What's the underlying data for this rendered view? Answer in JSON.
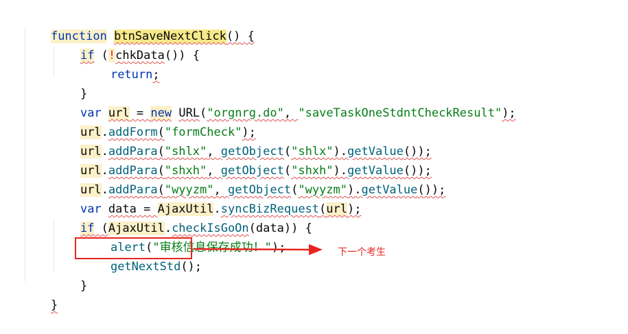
{
  "code": {
    "l1": {
      "kw": "function",
      "name": "btnSaveNextClick",
      "rest": "() {"
    },
    "l2": {
      "kw": "if",
      "open": " (",
      "bang": "!",
      "call": "chkData",
      "rest": "()) {"
    },
    "l3": {
      "kw": "return",
      "semi": ";"
    },
    "l4": {
      "brace": "}"
    },
    "l5": {
      "kw": "var",
      "var": "url",
      "eq": " = ",
      "new": "new",
      "cls": "URL",
      "p1": "(",
      "s1": "\"orgnrg.do\"",
      "c1": ", ",
      "s2": "\"saveTaskOneStdntCheckResult\"",
      "end": ");"
    },
    "l6": {
      "obj": "url",
      "dot": ".",
      "m": "addForm",
      "p1": "(",
      "s1": "\"formCheck\"",
      "end": ");"
    },
    "l7": {
      "obj": "url",
      "dot": ".",
      "m": "addPara",
      "p1": "(",
      "s1": "\"shlx\"",
      "c1": ", ",
      "m2": "getObject",
      "p2": "(",
      "s2": "\"shlx\"",
      "p3": ").",
      "m3": "getValue",
      "end": "());"
    },
    "l8": {
      "obj": "url",
      "dot": ".",
      "m": "addPara",
      "p1": "(",
      "s1": "\"shxh\"",
      "c1": ", ",
      "m2": "getObject",
      "p2": "(",
      "s2": "\"shxh\"",
      "p3": ").",
      "m3": "getValue",
      "end": "());"
    },
    "l9": {
      "obj": "url",
      "dot": ".",
      "m": "addPara",
      "p1": "(",
      "s1": "\"wyyzm\"",
      "c1": ", ",
      "m2": "getObject",
      "p2": "(",
      "s2": "\"wyyzm\"",
      "p3": ").",
      "m3": "getValue",
      "end": "());"
    },
    "l10": {
      "kw": "var",
      "var": "data",
      "eq": " = ",
      "cls": "AjaxUtil",
      "dot": ".",
      "m": "syncBizRequest",
      "p1": "(",
      "arg": "url",
      "end": ");"
    },
    "l11": {
      "kw": "if",
      "open": " (",
      "cls": "AjaxUtil",
      "dot": ".",
      "m": "checkIsGoOn",
      "p1": "(",
      "arg": "data",
      "end": ")) {"
    },
    "l12": {
      "call": "alert",
      "p1": "(",
      "s1": "\"审核信息保存成功！\"",
      "end": ");"
    },
    "l13": {
      "call": "getNextStd",
      "end": "();"
    },
    "l14": {
      "brace": "}"
    },
    "l15": {
      "brace": "}"
    }
  },
  "annotation": {
    "text": "下一个考生"
  },
  "colors": {
    "keyword": "#0033b3",
    "string": "#067d17",
    "function": "#00627a",
    "annotation": "#e8241f"
  }
}
